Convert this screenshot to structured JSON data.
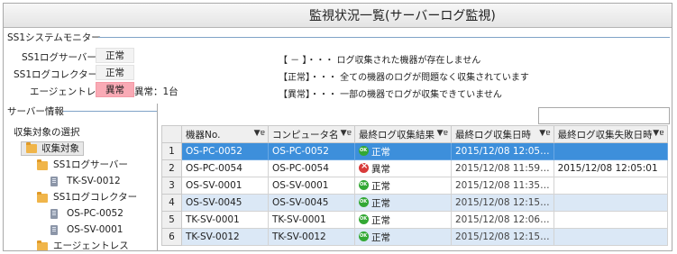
{
  "window": {
    "title": "監視状況一覧(サーバーログ監視)"
  },
  "monitor": {
    "section_title": "SS1システムモニター",
    "rows": [
      {
        "label": "SS1ログサーバー：",
        "status": "正常"
      },
      {
        "label": "SS1ログコレクター：",
        "status": "正常"
      },
      {
        "label": "エージェントレス：",
        "status": "異常",
        "count_text": "異常：1台"
      }
    ],
    "colors": {
      "normal_bg": "#f3f3f3",
      "alert_bg": "#f9aab5",
      "ok_icon": "#33a834",
      "error_icon": "#d83a3a",
      "selection": "#3d8fdb",
      "alt_row": "#dbe8f6"
    }
  },
  "legend": [
    "【 － 】・・・ ログ収集された機器が存在しません",
    "【正常】・・・ 全ての機器のログが問題なく収集されています",
    "【異常】・・・ 一部の機器でログが収集できていません"
  ],
  "server_info": {
    "section_title": "サーバー情報",
    "tree_title": "収集対象の選択",
    "tree": [
      {
        "label": "収集対象",
        "icon": "folder-icon",
        "level": 0
      },
      {
        "label": "SS1ログサーバー",
        "icon": "folder-icon",
        "level": 1
      },
      {
        "label": "TK-SV-0012",
        "icon": "server-icon",
        "level": 2
      },
      {
        "label": "SS1ログコレクター",
        "icon": "folder-icon",
        "level": 1
      },
      {
        "label": "OS-PC-0052",
        "icon": "server-icon",
        "level": 2
      },
      {
        "label": "OS-SV-0001",
        "icon": "server-icon",
        "level": 2
      },
      {
        "label": "エージェントレス",
        "icon": "folder-icon",
        "level": 1
      }
    ]
  },
  "grid": {
    "columns": [
      "",
      "機器No.",
      "コンピュータ名",
      "最終ログ収集結果",
      "最終ログ収集日時",
      "最終ログ収集失敗日時"
    ],
    "filter_glyph": "▼ɐ",
    "rows": [
      {
        "num": "1",
        "device": "OS-PC-0052",
        "computer": "OS-PC-0052",
        "result": "正常",
        "status": "ok",
        "last": "2015/12/08  12:05…",
        "fail": ""
      },
      {
        "num": "2",
        "device": "OS-PC-0054",
        "computer": "OS-PC-0054",
        "result": "異常",
        "status": "error",
        "last": "2015/12/08  11:59…",
        "fail": "2015/12/08 12:05:01"
      },
      {
        "num": "3",
        "device": "OS-SV-0001",
        "computer": "OS-SV-0001",
        "result": "正常",
        "status": "ok",
        "last": "2015/12/08  11:35…",
        "fail": ""
      },
      {
        "num": "4",
        "device": "OS-SV-0045",
        "computer": "OS-SV-0045",
        "result": "正常",
        "status": "ok",
        "last": "2015/12/08  12:15…",
        "fail": ""
      },
      {
        "num": "5",
        "device": "TK-SV-0001",
        "computer": "TK-SV-0001",
        "result": "正常",
        "status": "ok",
        "last": "2015/12/08  12:06…",
        "fail": ""
      },
      {
        "num": "6",
        "device": "TK-SV-0012",
        "computer": "TK-SV-0012",
        "result": "正常",
        "status": "ok",
        "last": "2015/12/08  12:15…",
        "fail": ""
      }
    ]
  }
}
